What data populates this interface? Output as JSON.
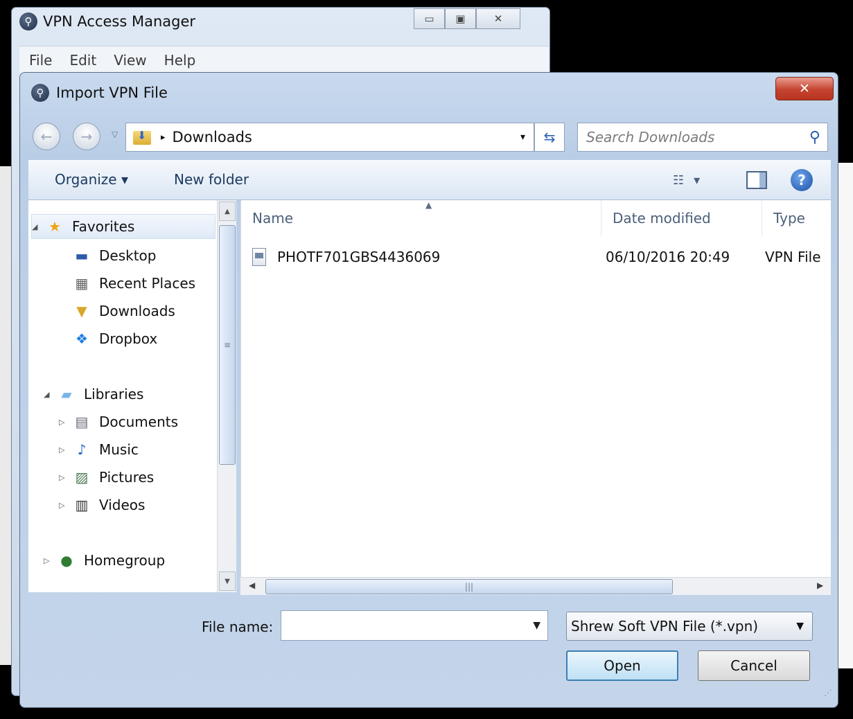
{
  "background_window": {
    "title": "VPN Access Manager",
    "controls": {
      "minimize": "▭",
      "maximize": "▣",
      "close": "✕"
    },
    "menu": [
      "File",
      "Edit",
      "View",
      "Help"
    ]
  },
  "dialog": {
    "title": "Import VPN File",
    "close_label": "✕",
    "address": {
      "current_folder": "Downloads",
      "separator": "▸",
      "dropdown": "▾"
    },
    "search_placeholder": "Search Downloads",
    "toolbar": {
      "organize": "Organize ▾",
      "new_folder": "New folder"
    },
    "nav_tree": [
      {
        "label": "Favorites",
        "icon": "star-icon",
        "glyph": "★",
        "color": "#f0a414",
        "arrow": "◢",
        "indent": 0,
        "group": true
      },
      {
        "label": "Desktop",
        "icon": "desktop-icon",
        "glyph": "▬",
        "color": "#2e5aa6",
        "arrow": "",
        "indent": 1
      },
      {
        "label": "Recent Places",
        "icon": "recent-places-icon",
        "glyph": "▦",
        "color": "#666",
        "arrow": "",
        "indent": 1
      },
      {
        "label": "Downloads",
        "icon": "downloads-folder-icon",
        "glyph": "▼",
        "color": "#d9a62b",
        "arrow": "",
        "indent": 1
      },
      {
        "label": "Dropbox",
        "icon": "dropbox-icon",
        "glyph": "❖",
        "color": "#1b7de0",
        "arrow": "",
        "indent": 1
      },
      {
        "label": "Libraries",
        "icon": "libraries-icon",
        "glyph": "▰",
        "color": "#7ab5e8",
        "arrow": "◢",
        "indent": 0,
        "group": true
      },
      {
        "label": "Documents",
        "icon": "documents-icon",
        "glyph": "▤",
        "color": "#667",
        "arrow": "▷",
        "indent": 1
      },
      {
        "label": "Music",
        "icon": "music-icon",
        "glyph": "♪",
        "color": "#1d63c7",
        "arrow": "▷",
        "indent": 1
      },
      {
        "label": "Pictures",
        "icon": "pictures-icon",
        "glyph": "▨",
        "color": "#4c7c56",
        "arrow": "▷",
        "indent": 1
      },
      {
        "label": "Videos",
        "icon": "videos-icon",
        "glyph": "▥",
        "color": "#333",
        "arrow": "▷",
        "indent": 1
      },
      {
        "label": "Homegroup",
        "icon": "homegroup-icon",
        "glyph": "●",
        "color": "#2e7d32",
        "arrow": "▷",
        "indent": 0,
        "group": true
      }
    ],
    "columns": {
      "name": "Name",
      "date_modified": "Date modified",
      "type": "Type",
      "sort_indicator": "▲"
    },
    "files": [
      {
        "name": "PHOTF701GBS4436069",
        "date_modified": "06/10/2016 20:49",
        "type": "VPN File"
      }
    ],
    "file_name_label": "File name:",
    "file_name_value": "",
    "file_type": "Shrew Soft VPN File (*.vpn)",
    "open_label": "Open",
    "cancel_label": "Cancel"
  }
}
